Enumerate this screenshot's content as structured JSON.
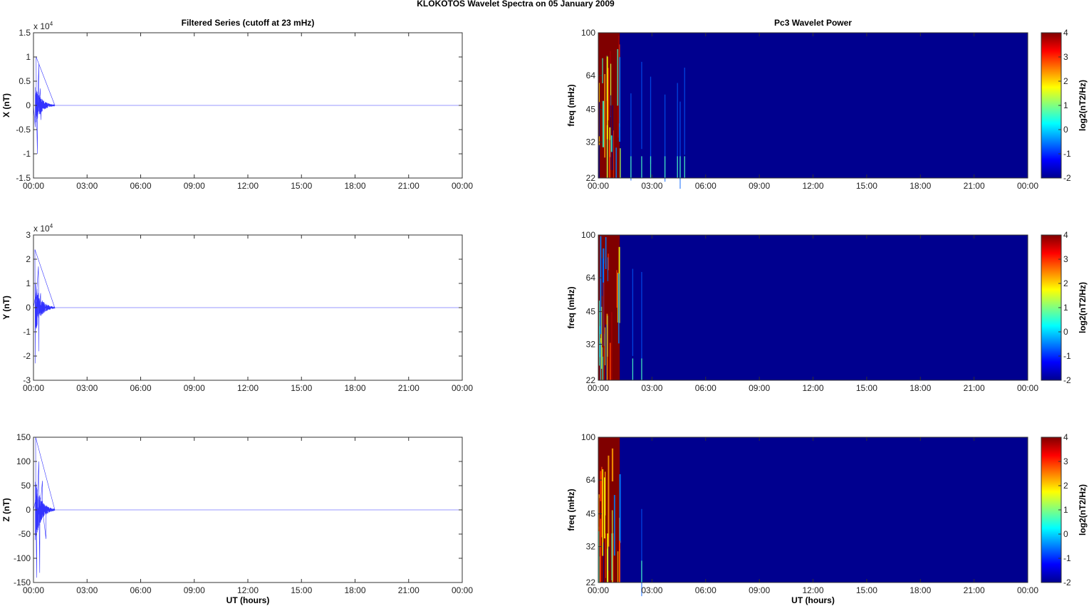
{
  "figure_title": "KLOKOTOS Wavelet Spectra on 05 January   2009",
  "xlabel": "UT (hours)",
  "time_ticks": [
    "00:00",
    "03:00",
    "06:00",
    "09:00",
    "12:00",
    "15:00",
    "18:00",
    "21:00",
    "00:00"
  ],
  "colors": {
    "line": "#0000ff",
    "low": "#00008f",
    "high": "#800000"
  },
  "chart_data": [
    {
      "type": "line",
      "title": "Filtered Series (cutoff at 23 mHz)",
      "ylabel": "X (nT)",
      "exponent": "x 10",
      "exponent_power": "4",
      "xlim": [
        0,
        24
      ],
      "ylim": [
        -1.5,
        1.5
      ],
      "yticks": [
        -1.5,
        -1,
        -0.5,
        0,
        0.5,
        1,
        1.5
      ],
      "ytick_labels": [
        "-1.5",
        "-1",
        "-0.5",
        "0",
        "0.5",
        "1",
        "1.5"
      ],
      "burst": {
        "start_h": 0.1,
        "end_h": 1.2,
        "peak": 1.0,
        "spikes": [
          [
            0.15,
            1.0
          ],
          [
            0.22,
            -1.0
          ],
          [
            0.3,
            0.85
          ],
          [
            0.38,
            0.35
          ],
          [
            0.42,
            -0.3
          ]
        ]
      }
    },
    {
      "type": "line",
      "title": "",
      "ylabel": "Y (nT)",
      "exponent": "x 10",
      "exponent_power": "4",
      "xlim": [
        0,
        24
      ],
      "ylim": [
        -3,
        3
      ],
      "yticks": [
        -3,
        -2,
        -1,
        0,
        1,
        2,
        3
      ],
      "ytick_labels": [
        "-3",
        "-2",
        "-1",
        "0",
        "1",
        "2",
        "3"
      ],
      "burst": {
        "start_h": 0.1,
        "end_h": 1.2,
        "peak": 2.4,
        "spikes": [
          [
            0.08,
            2.4
          ],
          [
            0.1,
            -2.3
          ],
          [
            0.28,
            1.7
          ],
          [
            0.3,
            -1.8
          ],
          [
            0.4,
            0.6
          ]
        ]
      }
    },
    {
      "type": "line",
      "title": "",
      "ylabel": "Z (nT)",
      "exponent": "",
      "exponent_power": "",
      "xlim": [
        0,
        24
      ],
      "ylim": [
        -150,
        150
      ],
      "yticks": [
        -150,
        -100,
        -50,
        0,
        50,
        100,
        150
      ],
      "ytick_labels": [
        "-150",
        "-100",
        "-50",
        "0",
        "50",
        "100",
        "150"
      ],
      "burst": {
        "start_h": 0.1,
        "end_h": 1.2,
        "peak": 150,
        "spikes": [
          [
            0.12,
            150
          ],
          [
            0.18,
            -140
          ],
          [
            0.3,
            100
          ],
          [
            0.35,
            -130
          ],
          [
            0.5,
            60
          ],
          [
            0.7,
            -60
          ]
        ]
      }
    },
    {
      "type": "heatmap",
      "title": "Pc3 Wavelet Power",
      "ylabel": "freq (mHz)",
      "xlim": [
        0,
        24
      ],
      "ylim": [
        22,
        100
      ],
      "yscale": "log",
      "yticks": [
        22,
        32,
        45,
        64,
        100
      ],
      "ytick_labels": [
        "22",
        "32",
        "45",
        "64",
        "100"
      ],
      "colorbar": {
        "label": "log2(nT2/Hz)",
        "clim": [
          -2,
          4
        ],
        "ticks": [
          "-2",
          "-1",
          "0",
          "1",
          "2",
          "3",
          "4"
        ]
      },
      "active_until_h": 1.2,
      "streak_times_h": [
        1.8,
        2.4,
        2.9,
        3.7,
        4.4,
        4.55,
        4.8
      ]
    },
    {
      "type": "heatmap",
      "title": "",
      "ylabel": "freq (mHz)",
      "xlim": [
        0,
        24
      ],
      "ylim": [
        22,
        100
      ],
      "yscale": "log",
      "yticks": [
        22,
        32,
        45,
        64,
        100
      ],
      "ytick_labels": [
        "22",
        "32",
        "45",
        "64",
        "100"
      ],
      "colorbar": {
        "label": "log2(nT2/Hz)",
        "clim": [
          -2,
          4
        ],
        "ticks": [
          "-2",
          "-1",
          "0",
          "1",
          "2",
          "3",
          "4"
        ]
      },
      "active_until_h": 1.2,
      "streak_times_h": [
        1.9,
        2.4
      ]
    },
    {
      "type": "heatmap",
      "title": "",
      "ylabel": "freq (mHz)",
      "xlim": [
        0,
        24
      ],
      "ylim": [
        22,
        100
      ],
      "yscale": "log",
      "yticks": [
        22,
        32,
        45,
        64,
        100
      ],
      "ytick_labels": [
        "22",
        "32",
        "45",
        "64",
        "100"
      ],
      "colorbar": {
        "label": "log2(nT2/Hz)",
        "clim": [
          -2,
          4
        ],
        "ticks": [
          "-2",
          "-1",
          "0",
          "1",
          "2",
          "3",
          "4"
        ]
      },
      "active_until_h": 1.2,
      "streak_times_h": [
        2.4
      ]
    }
  ]
}
